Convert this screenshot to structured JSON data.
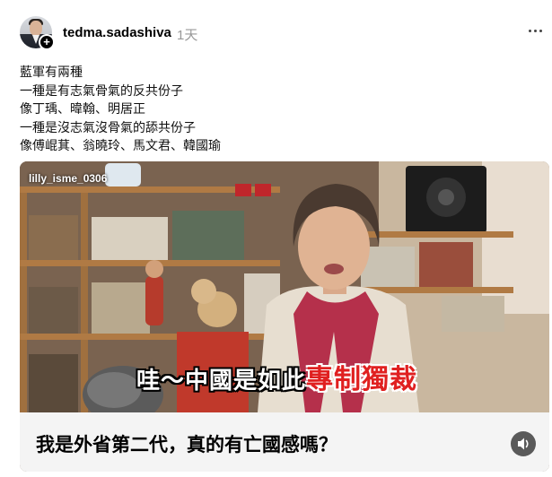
{
  "post": {
    "username": "tedma.sadashiva",
    "timestamp": "1天",
    "follow_badge": "+",
    "text_lines": [
      "藍軍有兩種",
      "一種是有志氣骨氣的反共份子",
      "像丁瑀、暐翰、明居正",
      "一種是沒志氣沒骨氣的舔共份子",
      "像傅崐萁、翁曉玲、馬文君、韓國瑜"
    ]
  },
  "media": {
    "channel_tag": "lilly_isme_0306",
    "subtitle_white": "哇〜中國是如此",
    "subtitle_red": "專制獨裁",
    "caption": "我是外省第二代，真的有亡國感嗎？"
  },
  "icons": {
    "more": "more-horizontal-icon",
    "sound": "speaker-icon"
  }
}
